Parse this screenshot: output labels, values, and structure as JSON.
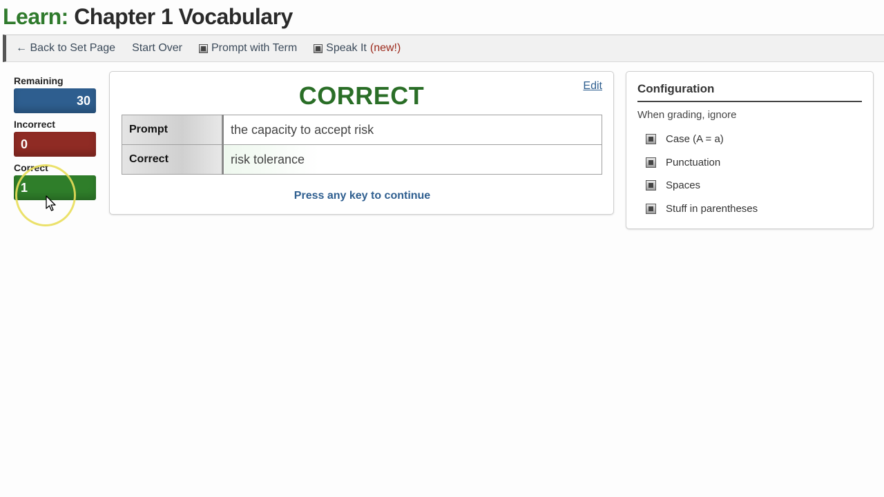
{
  "page": {
    "title_prefix": "Learn:",
    "title_main": "Chapter 1 Vocabulary"
  },
  "toolbar": {
    "back_label": "← Back to Set Page",
    "start_over_label": "Start Over",
    "prompt_with_term_label": "Prompt with Term",
    "prompt_with_term_checked": true,
    "speak_it_label": "Speak It",
    "speak_it_new": "(new!)",
    "speak_it_checked": true
  },
  "scores": {
    "remaining": {
      "label": "Remaining",
      "value": "30",
      "color": "#2e5e8f"
    },
    "incorrect": {
      "label": "Incorrect",
      "value": "0",
      "color": "#8f2b24"
    },
    "correct": {
      "label": "Correct",
      "value": "1",
      "color": "#2f7e2a"
    }
  },
  "feedback": {
    "heading": "CORRECT",
    "heading_color": "#2a6e27",
    "edit_label": "Edit",
    "rows": [
      {
        "label": "Prompt",
        "value": "the capacity to accept risk"
      },
      {
        "label": "Correct",
        "value": "risk tolerance"
      }
    ],
    "continue_text": "Press any key to continue"
  },
  "configuration": {
    "title": "Configuration",
    "subtitle": "When grading, ignore",
    "options": [
      {
        "label": "Case (A = a)",
        "checked": true
      },
      {
        "label": "Punctuation",
        "checked": true
      },
      {
        "label": "Spaces",
        "checked": true
      },
      {
        "label": "Stuff in parentheses",
        "checked": true
      }
    ]
  },
  "icons": {
    "checkbox": "checkbox-checked-icon",
    "pointer": "mouse-pointer-icon"
  }
}
